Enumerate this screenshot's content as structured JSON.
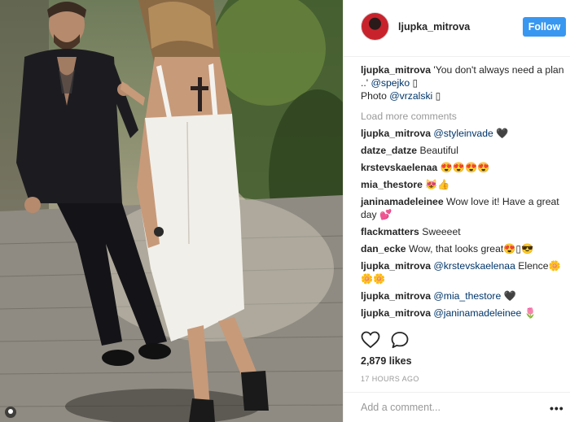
{
  "post": {
    "username": "ljupka_mitrova",
    "follow_label": "Follow",
    "caption": {
      "user": "ljupka_mitrova",
      "text_1": " 'You don't always need a plan ..' ",
      "mention_1": "@spejko",
      "emoji_1": " ▯",
      "text_2": "Photo ",
      "mention_2": "@vrzalski",
      "emoji_2": " ▯"
    },
    "load_more": "Load more comments",
    "comments": [
      {
        "user": "ljupka_mitrova",
        "mention": "@styleinvade",
        "text": " 🖤"
      },
      {
        "user": "datze_datze",
        "mention": "",
        "text": " Beautiful"
      },
      {
        "user": "krstevskaelenaa",
        "mention": "",
        "text": " 😍😍😍😍"
      },
      {
        "user": "mia_thestore",
        "mention": "",
        "text": " 😻👍"
      },
      {
        "user": "janinamadeleinee",
        "mention": "",
        "text": " Wow love it! Have a great day 💕"
      },
      {
        "user": "flackmatters",
        "mention": "",
        "text": " Sweeeet"
      },
      {
        "user": "dan_ecke",
        "mention": "",
        "text": " Wow, that looks great😍▯😎"
      },
      {
        "user": "ljupka_mitrova",
        "mention": "@krstevskaelenaa",
        "text": " Elence🌼🌼🌼"
      },
      {
        "user": "ljupka_mitrova",
        "mention": "@mia_thestore",
        "text": " 🖤"
      },
      {
        "user": "ljupka_mitrova",
        "mention": "@janinamadeleinee",
        "text": " 🌷"
      }
    ],
    "likes": "2,879 likes",
    "timestamp": "17 HOURS AGO",
    "add_comment_placeholder": "Add a comment...",
    "more_label": "•••"
  },
  "colors": {
    "follow_button": "#3897f0",
    "mention": "#003569",
    "muted": "#999999"
  }
}
